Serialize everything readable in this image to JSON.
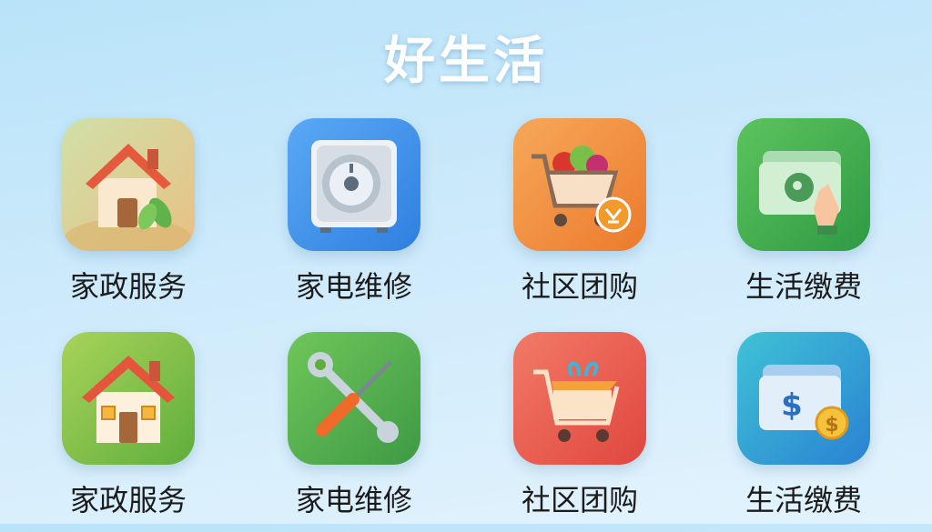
{
  "app": {
    "title": "好生活"
  },
  "services": [
    {
      "label": "家政服务",
      "icon": "house-plant-icon",
      "color": "#e7c48a"
    },
    {
      "label": "家电维修",
      "icon": "safe-icon",
      "color": "#3d8ee8"
    },
    {
      "label": "社区团购",
      "icon": "grocery-cart-icon",
      "color": "#f08f3c"
    },
    {
      "label": "生活缴费",
      "icon": "money-card-icon",
      "color": "#3fae52"
    },
    {
      "label": "家政服务",
      "icon": "house-icon",
      "color": "#7ec246"
    },
    {
      "label": "家电维修",
      "icon": "tools-icon",
      "color": "#4fae4e"
    },
    {
      "label": "社区团购",
      "icon": "shop-cart-icon",
      "color": "#e85b4d"
    },
    {
      "label": "生活缴费",
      "icon": "dollar-card-icon",
      "color": "#2b8fd4"
    }
  ]
}
